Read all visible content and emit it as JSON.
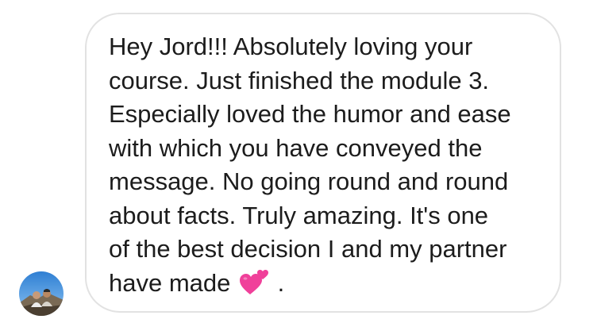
{
  "message": {
    "lines": [
      "Hey Jord!!! Absolutely loving your",
      "course. Just finished the module 3.",
      "Especially loved the humor and ease",
      "with which you have conveyed the",
      "message. No going round and round",
      "about facts. Truly amazing. It's one",
      "of the best decision I and my partner",
      "have made"
    ],
    "emoji": "two-hearts-icon",
    "trailing": " ."
  },
  "colors": {
    "text": "#1c1c1c",
    "bubble_border": "#e2e2e2",
    "heart": "#f0409a"
  }
}
